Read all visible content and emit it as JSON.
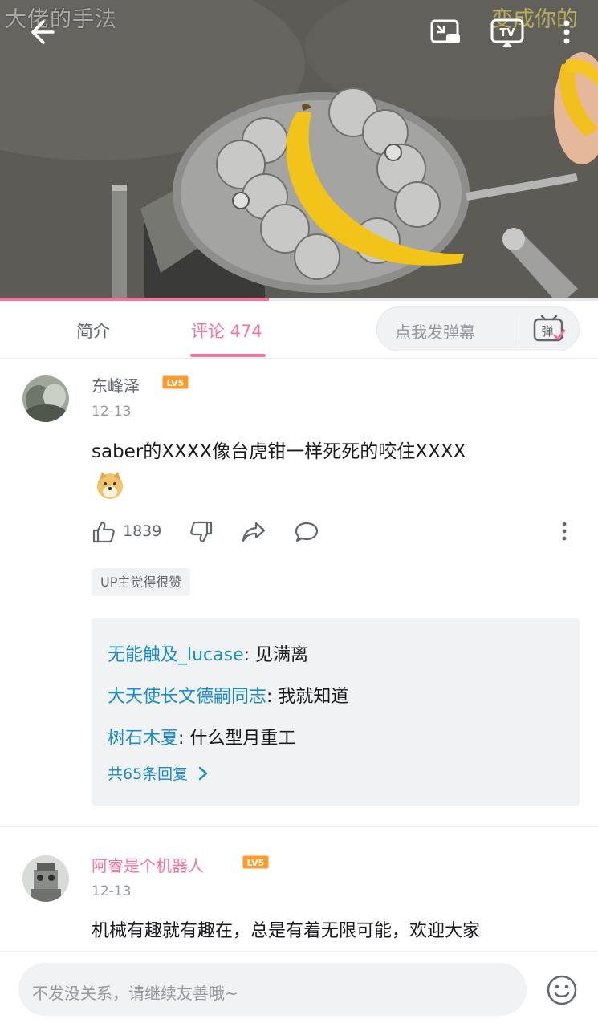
{
  "video": {
    "watermark_left": "大佬的手法",
    "watermark_right": "变成你的",
    "progress_fraction": 0.45
  },
  "tabs": {
    "intro": "简介",
    "comments": "评论 474",
    "danmaku_placeholder": "点我发弹幕",
    "danmaku_icon_char": "弹"
  },
  "comments": [
    {
      "user": "东峰泽",
      "level": "LV5",
      "date": "12-13",
      "text_line1": "saber的XXXX像台虎钳一样死死的咬住XXXX",
      "emoji": "doge",
      "likes": "1839",
      "up_tag": "UP主觉得很赞",
      "replies": [
        {
          "name": "无能触及_lucase",
          "sep": ": ",
          "text": "见满离"
        },
        {
          "name": "大天使长文德嗣同志",
          "sep": ": ",
          "text": "我就知道"
        },
        {
          "name": "树石木夏",
          "sep": ": ",
          "text": "什么型月重工"
        }
      ],
      "more_replies": "共65条回复"
    },
    {
      "user": "阿睿是个机器人",
      "level": "LV5",
      "date": "12-13",
      "text_line1": "机械有趣就有趣在，总是有着无限可能，欢迎大家"
    }
  ],
  "bottom": {
    "input_placeholder": "不发没关系，请继续友善哦~"
  },
  "colors": {
    "accent": "#fb7299",
    "link": "#178bcf",
    "level_badge": "#ff9b2b"
  }
}
